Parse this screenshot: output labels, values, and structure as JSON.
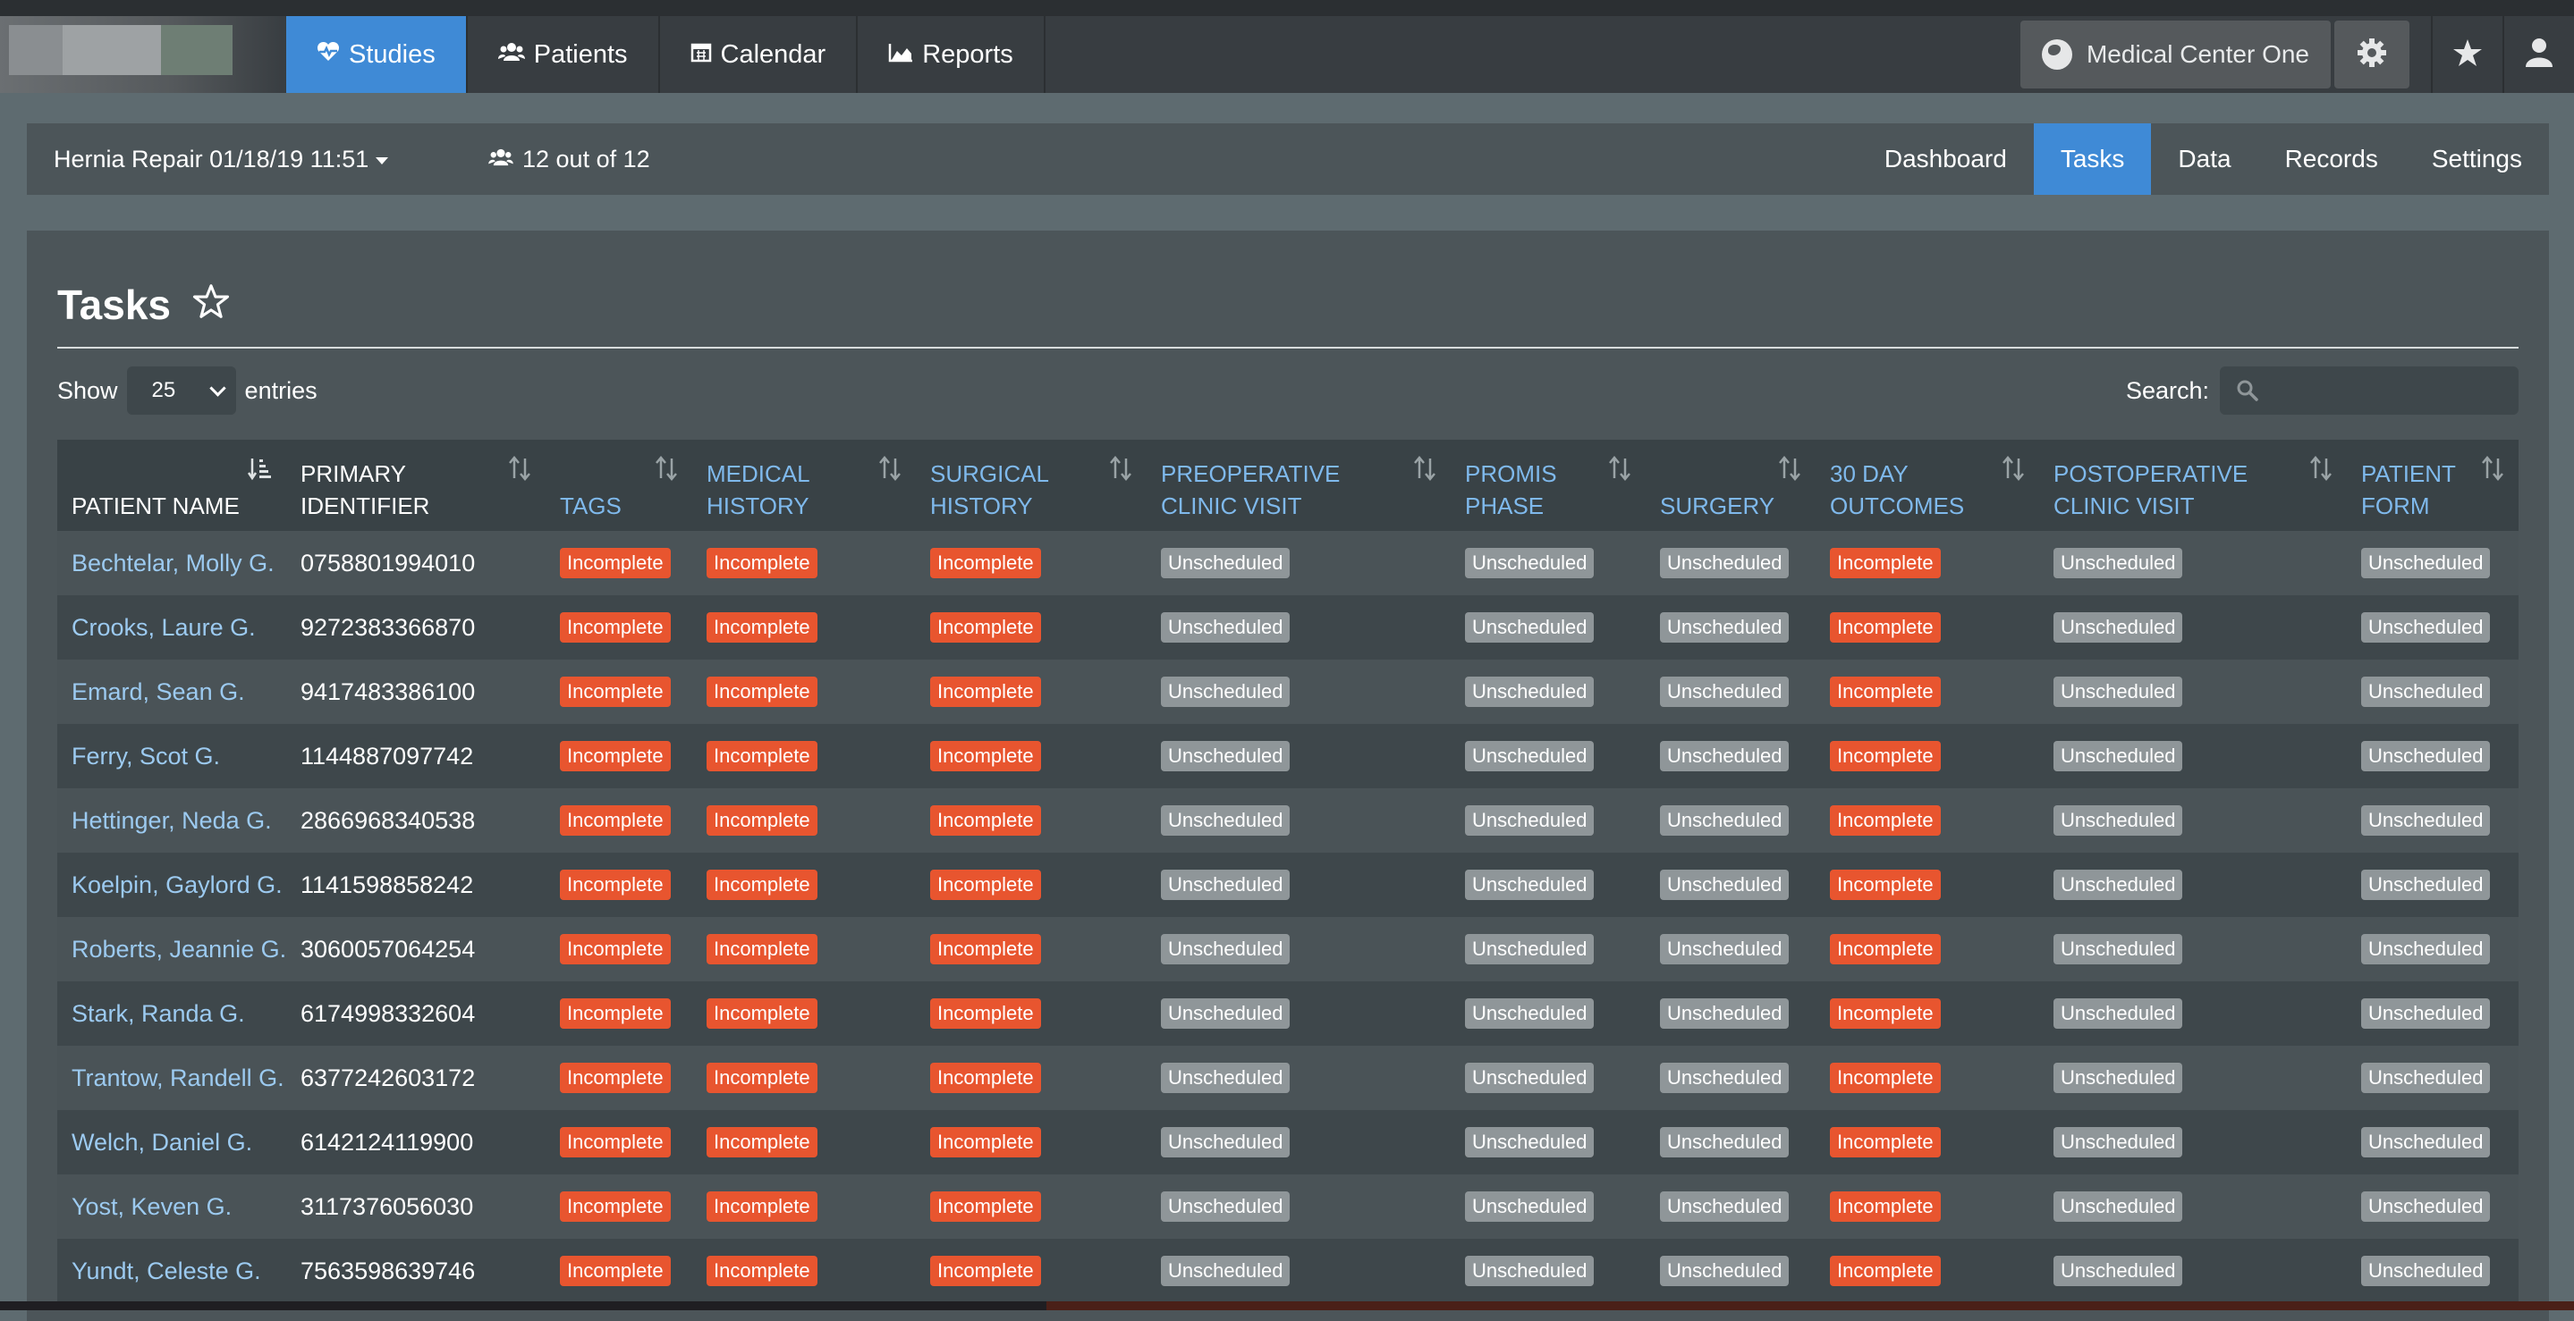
{
  "nav": {
    "tabs": [
      {
        "label": "Studies",
        "icon": "heartbeat-icon",
        "active": true
      },
      {
        "label": "Patients",
        "icon": "users-icon",
        "active": false
      },
      {
        "label": "Calendar",
        "icon": "calendar-icon",
        "active": false
      },
      {
        "label": "Reports",
        "icon": "area-chart-icon",
        "active": false
      }
    ],
    "center_label": "Medical Center One"
  },
  "subnav": {
    "study": "Hernia Repair 01/18/19 11:51",
    "count": "12 out of 12",
    "tabs": [
      "Dashboard",
      "Tasks",
      "Data",
      "Records",
      "Settings"
    ],
    "active_tab": "Tasks"
  },
  "page": {
    "title": "Tasks",
    "show_label": "Show",
    "entries_value": "25",
    "entries_label": "entries",
    "search_label": "Search:"
  },
  "columns": [
    {
      "line1": "PATIENT NAME",
      "line2": ""
    },
    {
      "line1": "PRIMARY",
      "line2": "IDENTIFIER"
    },
    {
      "line1": "TAGS",
      "line2": ""
    },
    {
      "line1": "MEDICAL",
      "line2": "HISTORY"
    },
    {
      "line1": "SURGICAL",
      "line2": "HISTORY"
    },
    {
      "line1": "PREOPERATIVE",
      "line2": "CLINIC VISIT"
    },
    {
      "line1": "PROMIS",
      "line2": "PHASE"
    },
    {
      "line1": "SURGERY",
      "line2": ""
    },
    {
      "line1": "30 DAY",
      "line2": "OUTCOMES"
    },
    {
      "line1": "POSTOPERATIVE",
      "line2": "CLINIC VISIT"
    },
    {
      "line1": "PATIENT",
      "line2": "FORM"
    }
  ],
  "status_labels": {
    "incomplete": "Incomplete",
    "unscheduled": "Unscheduled"
  },
  "colors": {
    "accent": "#3f8ad6",
    "incomplete": "#e8552f",
    "unscheduled": "#8f9699",
    "link": "#9ccaf0"
  },
  "rows": [
    {
      "name": "Bechtelar, Molly G.",
      "id": "0758801994010"
    },
    {
      "name": "Crooks, Laure G.",
      "id": "9272383366870"
    },
    {
      "name": "Emard, Sean G.",
      "id": "9417483386100"
    },
    {
      "name": "Ferry, Scot G.",
      "id": "1144887097742"
    },
    {
      "name": "Hettinger, Neda G.",
      "id": "2866968340538"
    },
    {
      "name": "Koelpin, Gaylord G.",
      "id": "1141598858242"
    },
    {
      "name": "Roberts, Jeannie G.",
      "id": "3060057064254"
    },
    {
      "name": "Stark, Randa G.",
      "id": "6174998332604"
    },
    {
      "name": "Trantow, Randell G.",
      "id": "6377242603172"
    },
    {
      "name": "Welch, Daniel G.",
      "id": "6142124119900"
    },
    {
      "name": "Yost, Keven G.",
      "id": "3117376056030"
    },
    {
      "name": "Yundt, Celeste G.",
      "id": "7563598639746"
    }
  ],
  "row_statuses": [
    "incomplete",
    "incomplete",
    "incomplete",
    "unscheduled",
    "unscheduled",
    "unscheduled",
    "incomplete",
    "unscheduled",
    "unscheduled"
  ]
}
